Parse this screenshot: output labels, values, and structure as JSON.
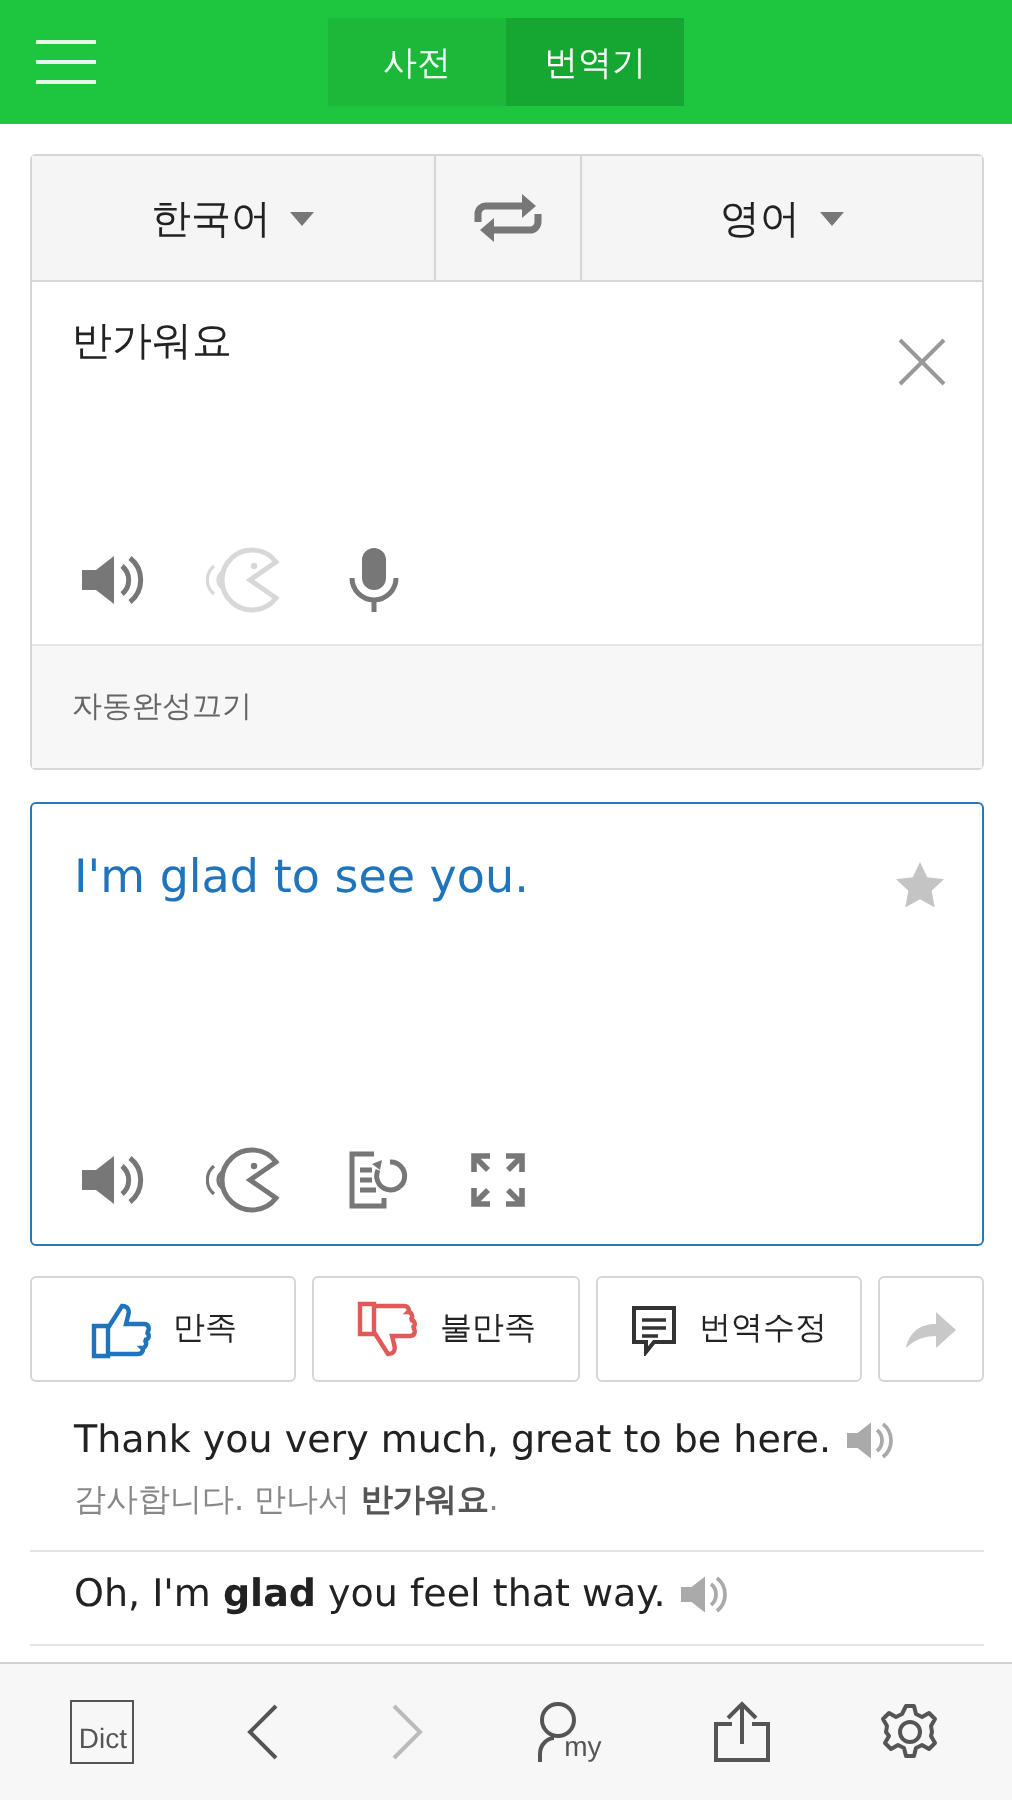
{
  "header": {
    "tabs": [
      {
        "label": "사전",
        "selected": false
      },
      {
        "label": "번역기",
        "selected": true
      }
    ]
  },
  "source": {
    "language": "한국어",
    "target_language": "영어",
    "text": "반가워요",
    "autocomplete": "자동완성끄기",
    "tools": [
      {
        "kind": "speak",
        "disabled": false
      },
      {
        "kind": "pronounce",
        "disabled": true
      },
      {
        "kind": "mic",
        "disabled": false
      }
    ]
  },
  "result": {
    "text": "I'm glad to see you.",
    "starred": false,
    "tools": [
      {
        "kind": "speak",
        "disabled": false
      },
      {
        "kind": "pronounce",
        "disabled": false
      },
      {
        "kind": "rewrite",
        "disabled": false
      },
      {
        "kind": "expand",
        "disabled": false
      }
    ]
  },
  "feedback": [
    {
      "kind": "like",
      "label": "만족"
    },
    {
      "kind": "dislike",
      "label": "불만족"
    },
    {
      "kind": "edit",
      "label": "번역수정"
    },
    {
      "kind": "share"
    }
  ],
  "examples": [
    {
      "english": "Thank you very much, great to be here.",
      "korean": "감사합니다. 만나서 **반가워요**."
    },
    {
      "english": "Oh, I'm **glad** you feel that way."
    }
  ],
  "bottom_nav": [
    {
      "kind": "dict",
      "label": "Dict",
      "disabled": false
    },
    {
      "kind": "back",
      "disabled": false
    },
    {
      "kind": "forward",
      "disabled": true
    },
    {
      "kind": "my",
      "label": "my",
      "disabled": false
    },
    {
      "kind": "share",
      "disabled": false
    },
    {
      "kind": "settings",
      "disabled": false
    }
  ]
}
